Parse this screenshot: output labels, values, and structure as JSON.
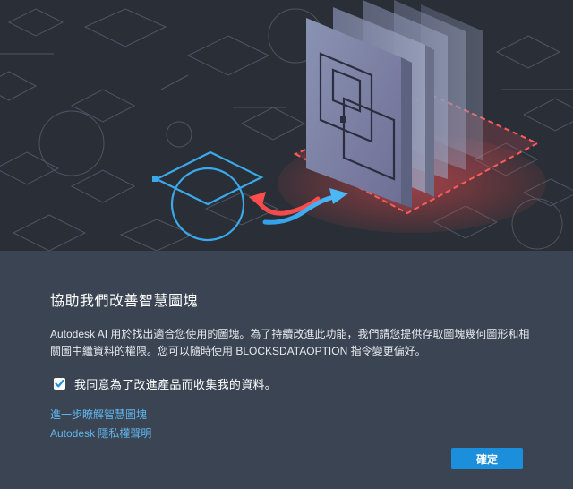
{
  "dialog": {
    "title": "協助我們改善智慧圖塊",
    "description": "Autodesk AI 用於找出適合您使用的圖塊。為了持續改進此功能，我們請您提供存取圖塊幾何圖形和相關圖中繼資料的權限。您可以隨時使用 BLOCKSDATAOPTION 指令變更偏好。",
    "consent": {
      "label": "我同意為了改進產品而收集我的資料。",
      "checked": true
    },
    "links": {
      "learn_more": "進一步瞭解智慧圖塊",
      "privacy": "Autodesk 隱私權聲明"
    },
    "ok_button": "確定"
  },
  "illustration": {
    "icons": [
      "grid-pattern",
      "block-outline-icon",
      "transfer-arrows-icon",
      "stacked-blocks-icon"
    ]
  },
  "colors": {
    "hero_bg": "#2a2f37",
    "panel_bg": "#3b4453",
    "accent_blue": "#1b8fdc",
    "link": "#5fb6ec",
    "highlight_red": "#e04848"
  }
}
